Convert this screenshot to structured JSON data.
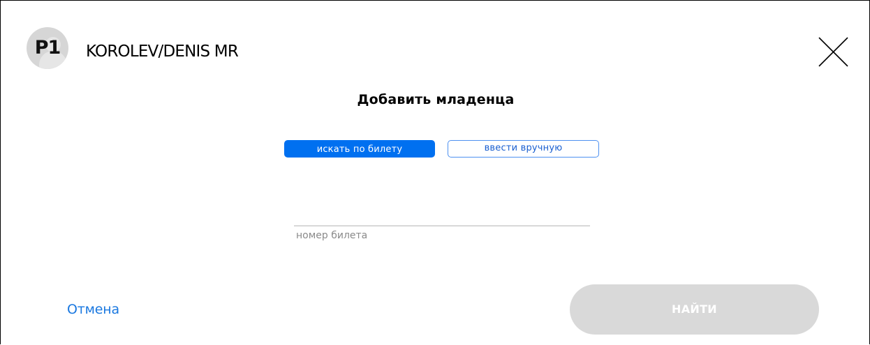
{
  "passenger": {
    "code": "P1",
    "name": "KOROLEV/DENIS MR"
  },
  "dialog": {
    "title": "Добавить младенца"
  },
  "modes": {
    "search_by_ticket": "искать по билету",
    "enter_manually": "ввести вручную",
    "active": "search_by_ticket"
  },
  "ticket_field": {
    "value": "",
    "label": "номер билета"
  },
  "actions": {
    "cancel": "Отмена",
    "find": "НАЙТИ",
    "find_enabled": false
  },
  "colors": {
    "accent": "#0070f0",
    "link": "#1a78e0",
    "disabled_button": "#d9d9d9"
  },
  "icons": {
    "close": "close-icon",
    "avatar": "avatar"
  }
}
